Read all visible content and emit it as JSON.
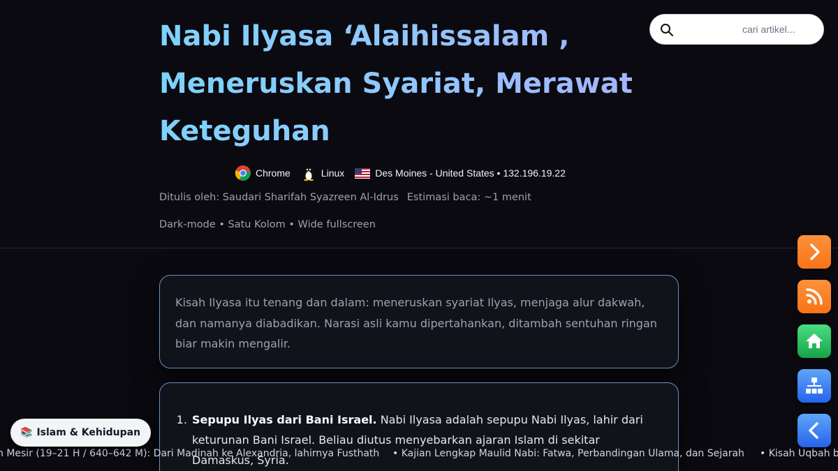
{
  "article": {
    "title_lines": [
      "Nabi Ilyasa ‘Alaihissalam ,",
      "Meneruskan Syariat, Merawat",
      "Keteguhan"
    ],
    "author": "Ditulis oleh: Saudari Sharifah Syazreen Al-Idrus",
    "read_estimate": "Estimasi baca: ~1 menit",
    "view_modes": "Dark-mode • Satu Kolom • Wide fullscreen"
  },
  "search": {
    "placeholder": "cari artikel..."
  },
  "visitor": {
    "browser": "Chrome",
    "os": "Linux",
    "location": "Des Moines - United States • 132.196.19.22"
  },
  "intro": {
    "text": "Kisah Ilyasa itu tenang dan dalam: meneruskan syariat Ilyas, menjaga alur dakwah, dan namanya diabadikan. Narasi asli kamu dipertahankan, ditambah sentuhan ringan biar makin mengalir."
  },
  "list": {
    "items": [
      {
        "heading": "Sepupu Ilyas dari Bani Israel.",
        "text": " Nabi Ilyasa adalah sepupu Nabi Ilyas, lahir dari keturunan Bani Israel. Beliau diutus menyebarkan ajaran Islam di sekitar Damaskus, Syria."
      }
    ]
  },
  "category_chip": {
    "label": "Islam & Kehidupan",
    "emoji": "📚"
  },
  "ticker": {
    "items": [
      "n Mesir (19–21 H / 640–642 M): Dari Madinah ke Alexandria, lahirnya Fusthath",
      "• Kajian Lengkap Maulid Nabi: Fatwa, Perbandingan Ulama, dan Sejarah",
      "• Kisah Uqbah b"
    ]
  },
  "colors": {
    "background": "#0a0a10",
    "card_border": "#6b8fc7",
    "orange": "#f97316",
    "green": "#16a34a",
    "blue": "#2563eb"
  }
}
